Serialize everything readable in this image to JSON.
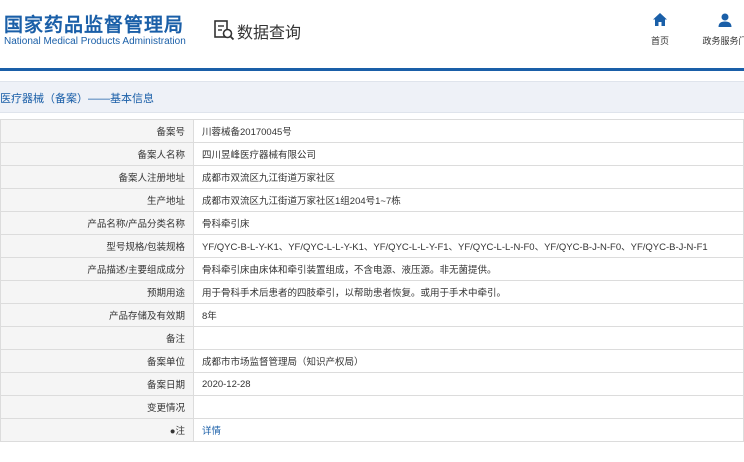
{
  "header": {
    "org_name_cn": "国家药品监督管理局",
    "org_name_en": "National Medical Products Administration",
    "section_title": "数据查询",
    "nav": [
      {
        "label": "首页",
        "icon": "home-icon"
      },
      {
        "label": "政务服务门",
        "icon": "user-icon"
      }
    ]
  },
  "breadcrumb": "医疗器械（备案）——基本信息",
  "rows": [
    {
      "label": "备案号",
      "value": "川蓉械备20170045号"
    },
    {
      "label": "备案人名称",
      "value": "四川昱峰医疗器械有限公司"
    },
    {
      "label": "备案人注册地址",
      "value": "成都市双流区九江街道万家社区"
    },
    {
      "label": "生产地址",
      "value": "成都市双流区九江街道万家社区1组204号1~7栋"
    },
    {
      "label": "产品名称/产品分类名称",
      "value": "骨科牵引床"
    },
    {
      "label": "型号规格/包装规格",
      "value": "YF/QYC-B-L-Y-K1、YF/QYC-L-L-Y-K1、YF/QYC-L-L-Y-F1、YF/QYC-L-L-N-F0、YF/QYC-B-J-N-F0、YF/QYC-B-J-N-F1"
    },
    {
      "label": "产品描述/主要组成成分",
      "value": "骨科牵引床由床体和牵引装置组成，不含电源、液压源。非无菌提供。"
    },
    {
      "label": "预期用途",
      "value": "用于骨科手术后患者的四肢牵引，以帮助患者恢复。或用于手术中牵引。"
    },
    {
      "label": "产品存储及有效期",
      "value": "8年"
    },
    {
      "label": "备注",
      "value": ""
    },
    {
      "label": "备案单位",
      "value": "成都市市场监督管理局（知识产权局）"
    },
    {
      "label": "备案日期",
      "value": "2020-12-28"
    },
    {
      "label": "变更情况",
      "value": ""
    },
    {
      "label": "●注",
      "value": "详情"
    }
  ],
  "colors": {
    "brand_blue": "#1a5fa8",
    "label_bg": "#f5f5f5",
    "border": "#dcdcdc"
  }
}
